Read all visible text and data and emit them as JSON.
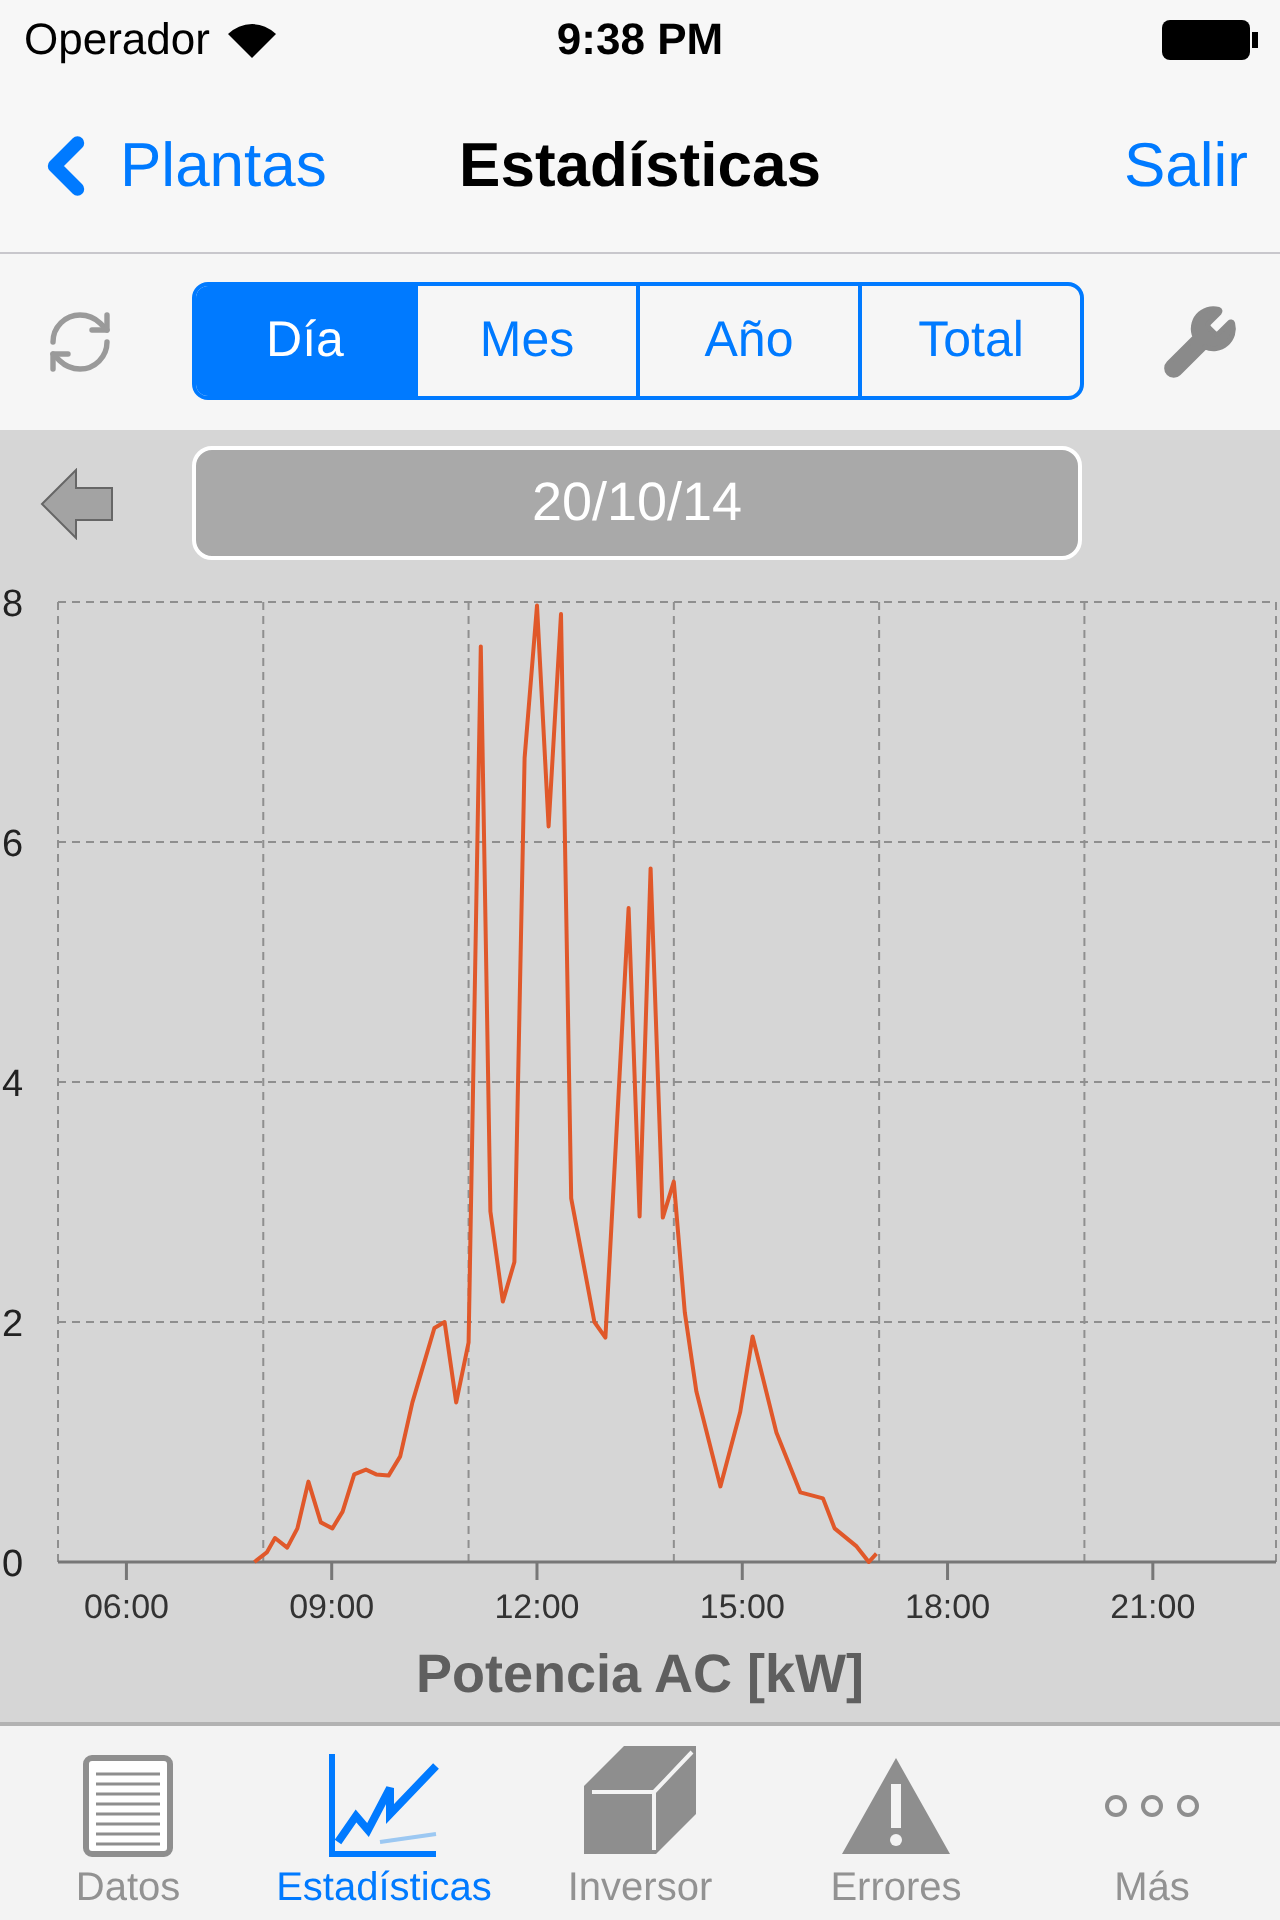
{
  "status_bar": {
    "carrier": "Operador",
    "time": "9:38 PM"
  },
  "nav": {
    "back": "Plantas",
    "title": "Estadísticas",
    "action": "Salir"
  },
  "segments": [
    {
      "label": "Día",
      "selected": true
    },
    {
      "label": "Mes",
      "selected": false
    },
    {
      "label": "Año",
      "selected": false
    },
    {
      "label": "Total",
      "selected": false
    }
  ],
  "date": "20/10/14",
  "chart_data": {
    "type": "line",
    "grid": true,
    "xlabel": "Potencia AC [kW]",
    "xlim": [
      5,
      22.8
    ],
    "ylim": [
      0,
      8
    ],
    "xticks": [
      {
        "value": 6,
        "label": "06:00"
      },
      {
        "value": 9,
        "label": "09:00"
      },
      {
        "value": 12,
        "label": "12:00"
      },
      {
        "value": 15,
        "label": "15:00"
      },
      {
        "value": 18,
        "label": "18:00"
      },
      {
        "value": 21,
        "label": "21:00"
      }
    ],
    "yticks": [
      0,
      2,
      4,
      6,
      8
    ],
    "x": [
      7.87,
      8.05,
      8.17,
      8.35,
      8.5,
      8.66,
      8.84,
      9.01,
      9.16,
      9.33,
      9.5,
      9.65,
      9.83,
      10.0,
      10.18,
      10.5,
      10.65,
      10.82,
      11.0,
      11.18,
      11.32,
      11.5,
      11.67,
      11.82,
      12.0,
      12.17,
      12.35,
      12.5,
      12.84,
      13.0,
      13.34,
      13.5,
      13.66,
      13.84,
      14.0,
      14.16,
      14.33,
      14.68,
      14.97,
      15.15,
      15.5,
      15.85,
      16.18,
      16.35,
      16.67,
      16.85,
      16.96
    ],
    "series": [
      {
        "color": "#e0582a",
        "values": [
          0,
          0.08,
          0.2,
          0.12,
          0.28,
          0.67,
          0.33,
          0.28,
          0.42,
          0.73,
          0.77,
          0.73,
          0.72,
          0.88,
          1.33,
          1.95,
          2.0,
          1.33,
          1.83,
          7.63,
          2.92,
          2.17,
          2.5,
          6.7,
          7.97,
          6.13,
          7.9,
          3.03,
          2.0,
          1.87,
          5.45,
          2.88,
          5.78,
          2.87,
          3.17,
          2.08,
          1.42,
          0.63,
          1.25,
          1.88,
          1.08,
          0.58,
          0.53,
          0.28,
          0.13,
          0,
          0.07
        ]
      }
    ]
  },
  "tabs": [
    {
      "label": "Datos",
      "selected": false
    },
    {
      "label": "Estadísticas",
      "selected": true
    },
    {
      "label": "Inversor",
      "selected": false
    },
    {
      "label": "Errores",
      "selected": false
    },
    {
      "label": "Más",
      "selected": false
    }
  ]
}
